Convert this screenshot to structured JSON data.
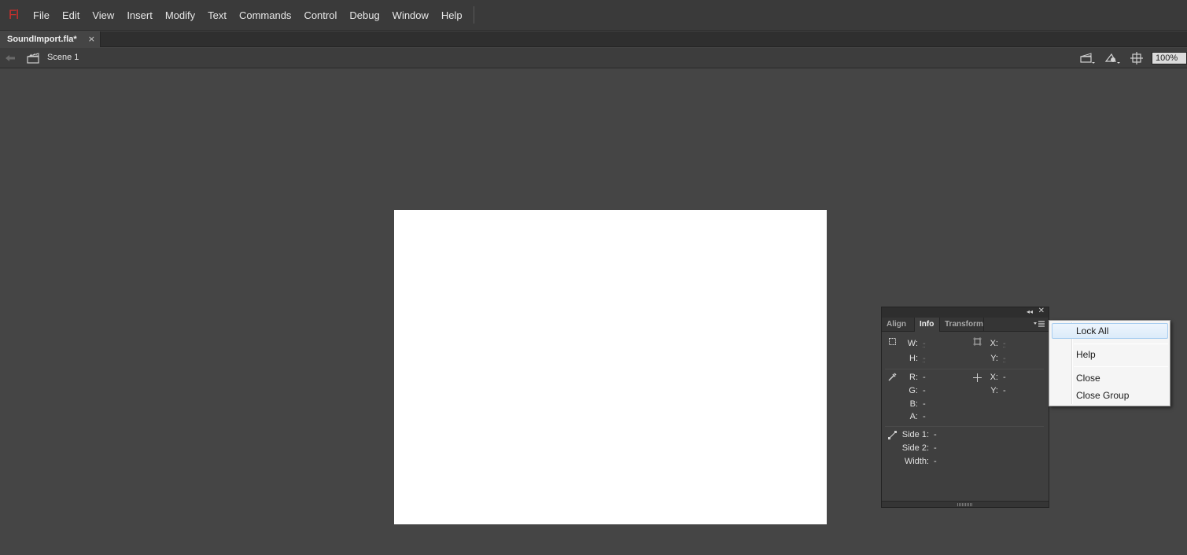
{
  "app": {
    "logo_text": "Fl"
  },
  "menubar": {
    "items": [
      "File",
      "Edit",
      "View",
      "Insert",
      "Modify",
      "Text",
      "Commands",
      "Control",
      "Debug",
      "Window",
      "Help"
    ]
  },
  "document_tab": {
    "label": "SoundImport.fla*",
    "close_glyph": "×"
  },
  "editbar": {
    "scene_label": "Scene 1",
    "zoom_value": "100%",
    "icons": [
      "back-arrow-icon",
      "scene-clapper-icon",
      "edit-scene-icon",
      "edit-symbols-icon",
      "center-stage-icon"
    ]
  },
  "stage": {
    "background": "#ffffff"
  },
  "panel": {
    "tabs": [
      {
        "label": "Align",
        "active": false
      },
      {
        "label": "Info",
        "active": true
      },
      {
        "label": "Transform",
        "active": false
      }
    ],
    "size": {
      "w_label": "W:",
      "w_value": "-",
      "h_label": "H:",
      "h_value": "-"
    },
    "position": {
      "x_label": "X:",
      "x_value": "-",
      "y_label": "Y:",
      "y_value": "-"
    },
    "color": {
      "r_label": "R:",
      "r_value": "-",
      "g_label": "G:",
      "g_value": "-",
      "b_label": "B:",
      "b_value": "-",
      "a_label": "A:",
      "a_value": "-"
    },
    "cursor": {
      "x_label": "X:",
      "x_value": "-",
      "y_label": "Y:",
      "y_value": "-"
    },
    "stroke": {
      "side1_label": "Side 1:",
      "side1_value": "-",
      "side2_label": "Side 2:",
      "side2_value": "-",
      "width_label": "Width:",
      "width_value": "-"
    }
  },
  "context_menu": {
    "items": [
      "Lock All",
      "Help",
      "Close",
      "Close Group"
    ],
    "highlighted": "Lock All"
  },
  "colors": {
    "workspace": "#454545",
    "menubar": "#3a3a3a",
    "logo": "#c9302c",
    "menu_highlight": "#dcebfa"
  }
}
